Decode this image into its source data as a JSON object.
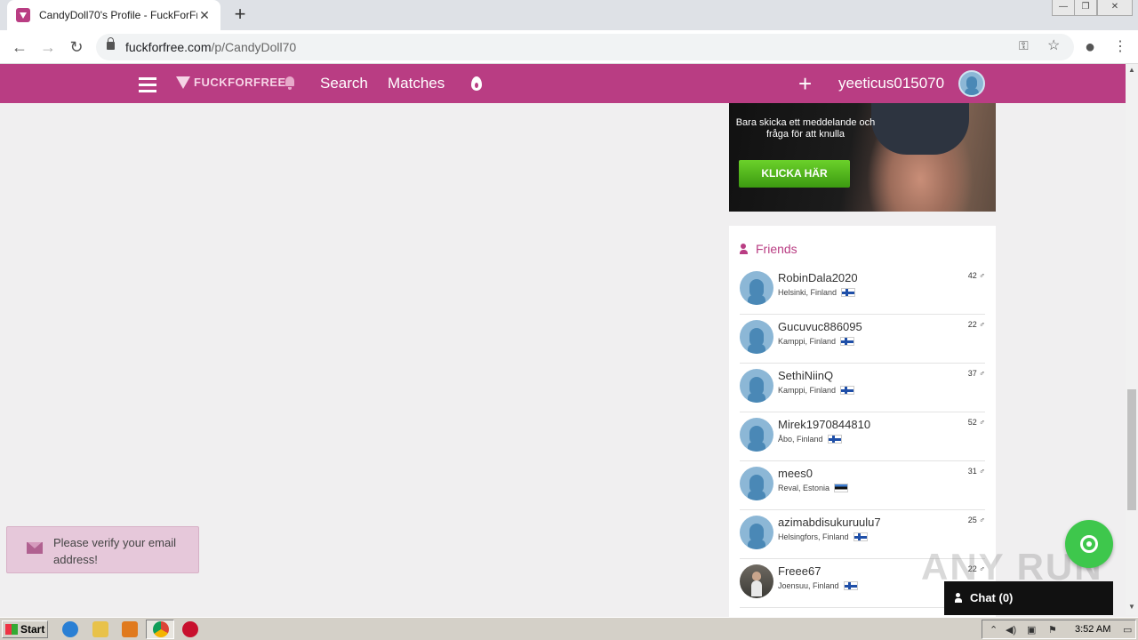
{
  "browser": {
    "tab_title": "CandyDoll70's Profile - FuckForFree",
    "tab_close": "✕",
    "new_tab": "+",
    "url_domain": "fuckforfree.com",
    "url_path": "/p/CandyDoll70",
    "window_controls": [
      "—",
      "❐",
      "✕"
    ]
  },
  "site": {
    "logo_text": "FUCKFORFREE",
    "nav": {
      "search": "Search",
      "matches": "Matches"
    },
    "username": "yeeticus015070",
    "plus": "+"
  },
  "ad": {
    "text": "Bara skicka ett meddelande och fråga för att knulla",
    "button": "KLICKA HÄR"
  },
  "friends": {
    "title": "Friends",
    "items": [
      {
        "name": "RobinDala2020",
        "location": "Helsinki, Finland",
        "flag": "fi",
        "age": "42 ♂"
      },
      {
        "name": "Gucuvuc886095",
        "location": "Kamppi, Finland",
        "flag": "fi",
        "age": "22 ♂"
      },
      {
        "name": "SethiNiinQ",
        "location": "Kamppi, Finland",
        "flag": "fi",
        "age": "37 ♂"
      },
      {
        "name": "Mirek1970844810",
        "location": "Åbo, Finland",
        "flag": "fi",
        "age": "52 ♂"
      },
      {
        "name": "mees0",
        "location": "Reval, Estonia",
        "flag": "ee",
        "age": "31 ♂"
      },
      {
        "name": "azimabdisukuruulu7",
        "location": "Helsingfors, Finland",
        "flag": "fi",
        "age": "25 ♂"
      },
      {
        "name": "Freee67",
        "location": "Joensuu, Finland",
        "flag": "fi",
        "age": "22 ♂"
      }
    ]
  },
  "toast": {
    "text": "Please verify your email address!"
  },
  "chat": {
    "label": "Chat (0)"
  },
  "watermark": "ANY RUN",
  "taskbar": {
    "start": "Start",
    "clock": "3:52 AM"
  },
  "colors": {
    "brand": "#b93d83",
    "fab": "#3ec74c",
    "ad_button": "#4caf1a"
  }
}
